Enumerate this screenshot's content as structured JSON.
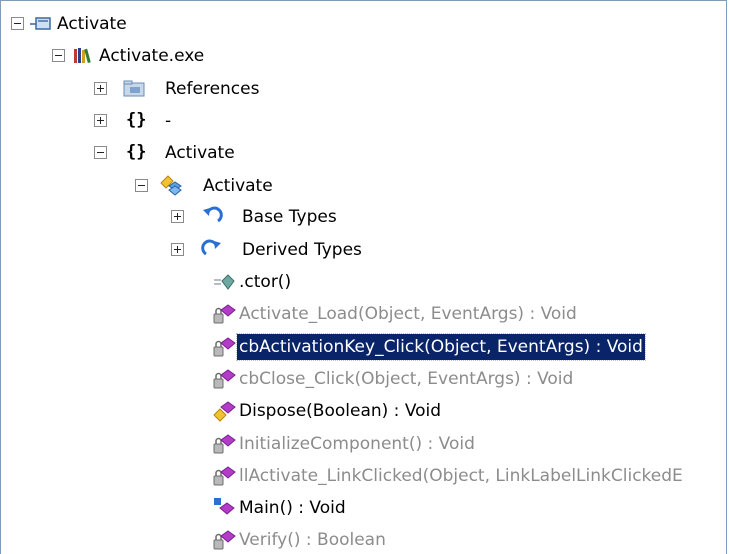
{
  "tree": {
    "root": {
      "label": "Activate",
      "icon": "module-icon",
      "expanded": true
    },
    "assembly": {
      "label": "Activate.exe",
      "icon": "assembly-books-icon",
      "expanded": true
    },
    "references": {
      "label": "References",
      "icon": "references-folder-icon",
      "expanded": false
    },
    "namespace_dash": {
      "label": "-",
      "icon": "namespace-braces-icon",
      "braces": "{}",
      "expanded": false
    },
    "namespace_activate": {
      "label": "Activate",
      "icon": "namespace-braces-icon",
      "braces": "{}",
      "expanded": true
    },
    "class_activate": {
      "label": "Activate",
      "icon": "class-icon",
      "expanded": true
    },
    "base_types": {
      "label": "Base Types",
      "icon": "base-types-icon",
      "expanded": false
    },
    "derived_types": {
      "label": "Derived Types",
      "icon": "derived-types-icon",
      "expanded": false
    },
    "members": [
      {
        "label": ".ctor()",
        "icon": "constructor-icon",
        "style": "normal"
      },
      {
        "label": "Activate_Load(Object, EventArgs) : Void",
        "icon": "private-method-icon",
        "style": "gray"
      },
      {
        "label": "cbActivationKey_Click(Object, EventArgs) : Void",
        "icon": "private-method-icon",
        "style": "selected"
      },
      {
        "label": "cbClose_Click(Object, EventArgs) : Void",
        "icon": "private-method-icon",
        "style": "gray"
      },
      {
        "label": "Dispose(Boolean) : Void",
        "icon": "protected-method-icon",
        "style": "normal"
      },
      {
        "label": "InitializeComponent() : Void",
        "icon": "private-method-icon",
        "style": "gray"
      },
      {
        "label": "llActivate_LinkClicked(Object, LinkLabelLinkClickedE",
        "icon": "private-method-icon",
        "style": "gray"
      },
      {
        "label": "Main() : Void",
        "icon": "static-method-icon",
        "style": "normal"
      },
      {
        "label": "Verify() : Boolean",
        "icon": "private-method-icon",
        "style": "gray"
      }
    ]
  },
  "colors": {
    "selection_bg": "#0a246a",
    "selection_fg": "#ffffff",
    "gray_text": "#8c8c8c",
    "method_purple": "#b23cc8",
    "border": "#7f9db9"
  }
}
